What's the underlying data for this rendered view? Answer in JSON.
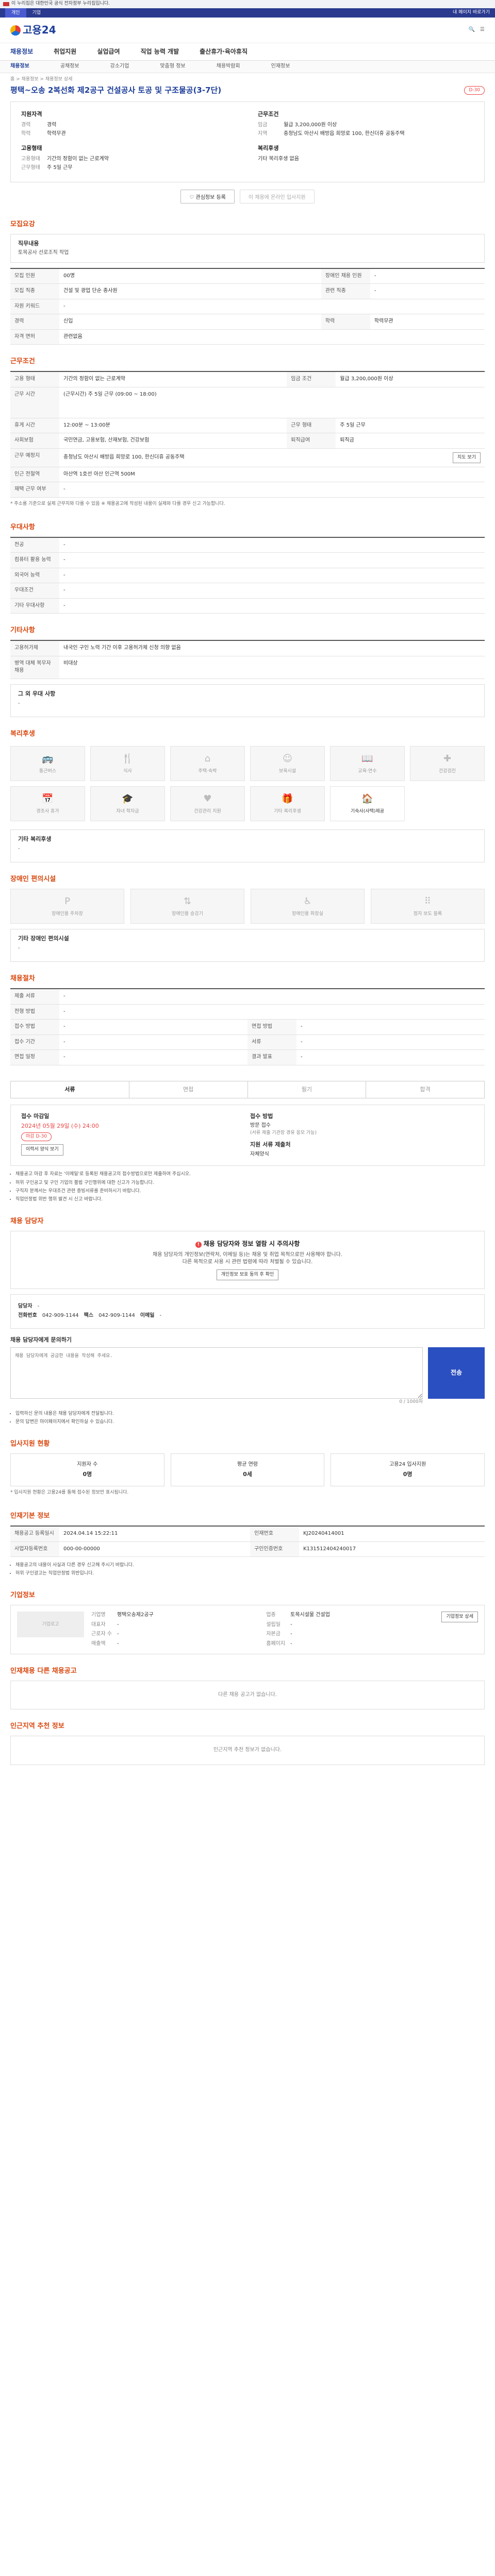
{
  "gov_bar": {
    "text": "이 누리집은 대한민국 공식 전자정부 누리집입니다."
  },
  "top_bar": {
    "tab_active": "개인",
    "tab_other": "기업",
    "right": "내 페이지 바로가기"
  },
  "header": {
    "logo": "고용24"
  },
  "gnb": {
    "items": [
      "채용정보",
      "취업지원",
      "실업급여",
      "직업 능력 개발",
      "출산휴가·육아휴직"
    ]
  },
  "sub_tabs": {
    "items": [
      "채용정보",
      "공채정보",
      "강소기업",
      "맞춤형 정보",
      "채용박람회",
      "인재정보"
    ]
  },
  "breadcrumb": "홈 > 채용정보 > 채용정보 상세",
  "job": {
    "title": "평택~오송 2복선화 제2공구 건설공사 토공 및 구조물공(3-7단)",
    "badge": "D-30",
    "summary": {
      "left_title": "지원자격",
      "left": [
        {
          "k": "경력",
          "v": "경력"
        },
        {
          "k": "학력",
          "v": "학력무관"
        }
      ],
      "left_title2": "고용형태",
      "left2": [
        {
          "k": "고용형태",
          "v": "기간의 정함이 없는 근로계약"
        },
        {
          "k": "근무형태",
          "v": "주 5일 근무"
        }
      ],
      "right_title": "근무조건",
      "right": [
        {
          "k": "임금",
          "v": "월급 3,200,000원 이상"
        },
        {
          "k": "지역",
          "v": "충청남도 아산시 배방읍 희망로 100, 한신더휴 공동주택"
        }
      ],
      "right_title2": "복리후생",
      "right2": [
        {
          "k": "",
          "v": "기타 복리후생 없음"
        }
      ]
    },
    "btn_fav": "관심정보 등록",
    "btn_apply": "이 채용에 온라인 입사지원"
  },
  "sections": {
    "recruit": "모집요강",
    "work": "근무조건",
    "prefer": "우대사항",
    "ability": "기타사항",
    "welfare": "복리후생",
    "disability": "장애인 편의시설",
    "process": "채용절차",
    "contact": "채용 담당자",
    "applicants": "입사지원 현황",
    "basic": "인재기본 정보",
    "company": "기업정보",
    "others": "인재채용 다른 채용공고",
    "nearby": "인근지역 추천 정보"
  },
  "recruit": {
    "box_title": "직무내용",
    "box_text": "토목공사 선로조직 작업",
    "rows": [
      [
        "모집 인원",
        "00명",
        "장애인 채용 인원",
        "-"
      ],
      [
        "모집 직종",
        "건설 및 광업 단순 종사원",
        "관련 직종",
        "-"
      ],
      [
        "자원 키워드",
        "-",
        "",
        ""
      ],
      [
        "경력",
        "신입",
        "학력",
        "학력무관"
      ],
      [
        "자격 면허",
        "관련없음",
        "",
        ""
      ]
    ]
  },
  "work": {
    "rows": [
      [
        "고용 형태",
        "기간의 정함이 없는 근로계약",
        "임금 조건",
        "월급 3,200,000원 이상"
      ],
      [
        "근무 시간",
        "(근무시간) 주 5일 근무 (09:00 ~ 18:00)",
        "",
        ""
      ],
      [
        "휴게 시간",
        "12:00분 ~ 13:00분",
        "근무 형태",
        "주 5일 근무"
      ],
      [
        "사회보험",
        "국민연금, 고용보험, 산재보험, 건강보험",
        "퇴직급여",
        "퇴직금"
      ],
      [
        "근무 예정지",
        "충청남도 아산시 배방읍 희망로 100, 한신더휴 공동주택",
        "",
        ""
      ],
      [
        "인근 전철역",
        "아산역 1호선 아산 인근역 500M",
        "",
        ""
      ],
      [
        "재택 근무 여부",
        "-",
        "",
        ""
      ]
    ],
    "map_btn": "지도 보기",
    "note": "* 주소를 기준으로 실제 근무지와 다를 수 있음 ※ 채용공고에 작성된 내용이 실제와 다를 경우 신고 가능합니다."
  },
  "prefer": {
    "rows": [
      [
        "전공",
        "-"
      ],
      [
        "컴퓨터 활용 능력",
        "-"
      ],
      [
        "외국어 능력",
        "-"
      ],
      [
        "우대조건",
        "-"
      ],
      [
        "기타 우대사항",
        "-"
      ]
    ]
  },
  "etc": {
    "rows": [
      [
        "고용허가제",
        "내국인 구인 노력 기간 이후 고용허가제 신청 의향 없음"
      ],
      [
        "병역 대체 복무자 채용",
        "비대상"
      ]
    ],
    "box_title": "그 외 우대 사항",
    "box_text": "-"
  },
  "welfare": {
    "icons": [
      "통근버스",
      "식사",
      "주택·숙박",
      "보육시설",
      "교육·연수",
      "건강검진",
      "경조사 휴가",
      "자녀 학자금",
      "건강관리 지원",
      "기타 복리후생",
      "기숙사(사택)제공"
    ],
    "active_index": 10,
    "box_title": "기타 복리후생",
    "box_text": "-"
  },
  "disability": {
    "icons": [
      "장애인용 주차장",
      "장애인용 승강기",
      "장애인용 화장실",
      "점자 보도 블록"
    ],
    "box_title": "기타 장애인 편의시설",
    "box_text": "-"
  },
  "process": {
    "rows": [
      [
        "제출 서류",
        "-",
        "",
        ""
      ],
      [
        "전형 방법",
        "-",
        "",
        ""
      ],
      [
        "접수 방법",
        "-",
        "면접 방법",
        "-"
      ],
      [
        "접수 기간",
        "-",
        "서류",
        "-"
      ],
      [
        "면접 일정",
        "-",
        "결과 발표",
        "-"
      ]
    ],
    "steps": [
      "서류",
      "면접",
      "필기",
      "합격"
    ],
    "deadline_h": "접수 마감일",
    "deadline": "2024년 05월 29일 (수) 24:00",
    "deadline_tag": "마감 D-30",
    "method_h": "접수 방법",
    "method": "방문 접수",
    "method_sub": "(서류 제출 기관장 경유 응모 가능)",
    "method_h2": "지원 서류 제출처",
    "method_v2": "자체양식",
    "apply_btn": "이력서 양식 보기",
    "notes": [
      "채용공고 마감 후 자료는 '이메일'로 등록된 채용공고의 접수방법으로만 제출하여 주십시오.",
      "허위 구인공고 및 구인 기업의 불법 구인행위에 대한 신고가 가능합니다.",
      "구직자 분께서는 우대조건 관련 증빙서류를 준비하시기 바랍니다.",
      "직업안정법 위반 행위 발견 시 신고 바랍니다."
    ]
  },
  "contact": {
    "alert_title": "채용 담당자와 정보 열람 시 주의사항",
    "alert_text1": "채용 담당자의 개인정보(연락처, 이메일 등)는 채용 및 취업 목적으로만 사용해야 합니다.",
    "alert_text2": "다른 목적으로 사용 시 관련 법령에 따라 처벌될 수 있습니다.",
    "agree_btn": "개인정보 보호 동의 후 확인",
    "name_k": "담당자",
    "name_v": "-",
    "tel_k": "전화번호",
    "tel_v": "042-909-1144",
    "fax_k": "팩스",
    "fax_v": "042-909-1144",
    "mail_k": "이메일",
    "mail_v": "-",
    "ta_title": "채용 담당자에게 문의하기",
    "ta_placeholder": "채용 담당자에게 궁금한 내용을 작성해 주세요.",
    "send": "전송",
    "ta_count": "0 / 1000자",
    "ta_notes": [
      "입력하신 문의 내용은 채용 담당자에게 전달됩니다.",
      "문의 답변은 마이페이지에서 확인하실 수 있습니다."
    ]
  },
  "applicants": {
    "stats": [
      {
        "label": "지원자 수",
        "value": "0명"
      },
      {
        "label": "평균 연령",
        "value": "0세"
      },
      {
        "label": "고용24 입사지원",
        "value": "0명"
      }
    ],
    "note": "* 입사지원 현황은 고용24를 통해 접수된 정보만 표시됩니다."
  },
  "basic": {
    "rows": [
      [
        "채용공고 등록일시",
        "2024.04.14 15:22:11",
        "인재번호",
        "KJ20240414001",
        ""
      ],
      [
        "사업자등록번호",
        "000-00-00000",
        "구인인증번호",
        "K131512404240017"
      ]
    ],
    "notes": [
      "채용공고의 내용이 사실과 다른 경우 신고해 주시기 바랍니다.",
      "허위 구인광고는 직업안정법 위반입니다."
    ]
  },
  "company": {
    "logo_alt": "기업로고",
    "fields": [
      [
        "기업명",
        "평택오송제2공구",
        "업종",
        "토목시설물 건설업"
      ],
      [
        "대표자",
        "-",
        "설립일",
        "-"
      ],
      [
        "근로자 수",
        "-",
        "자본금",
        "-"
      ],
      [
        "매출액",
        "-",
        "홈페이지",
        "-"
      ]
    ],
    "more_btn": "기업정보 상세"
  },
  "others": {
    "empty": "다른 채용 공고가 없습니다."
  },
  "nearby": {
    "empty": "인근지역 추천 정보가 없습니다."
  }
}
